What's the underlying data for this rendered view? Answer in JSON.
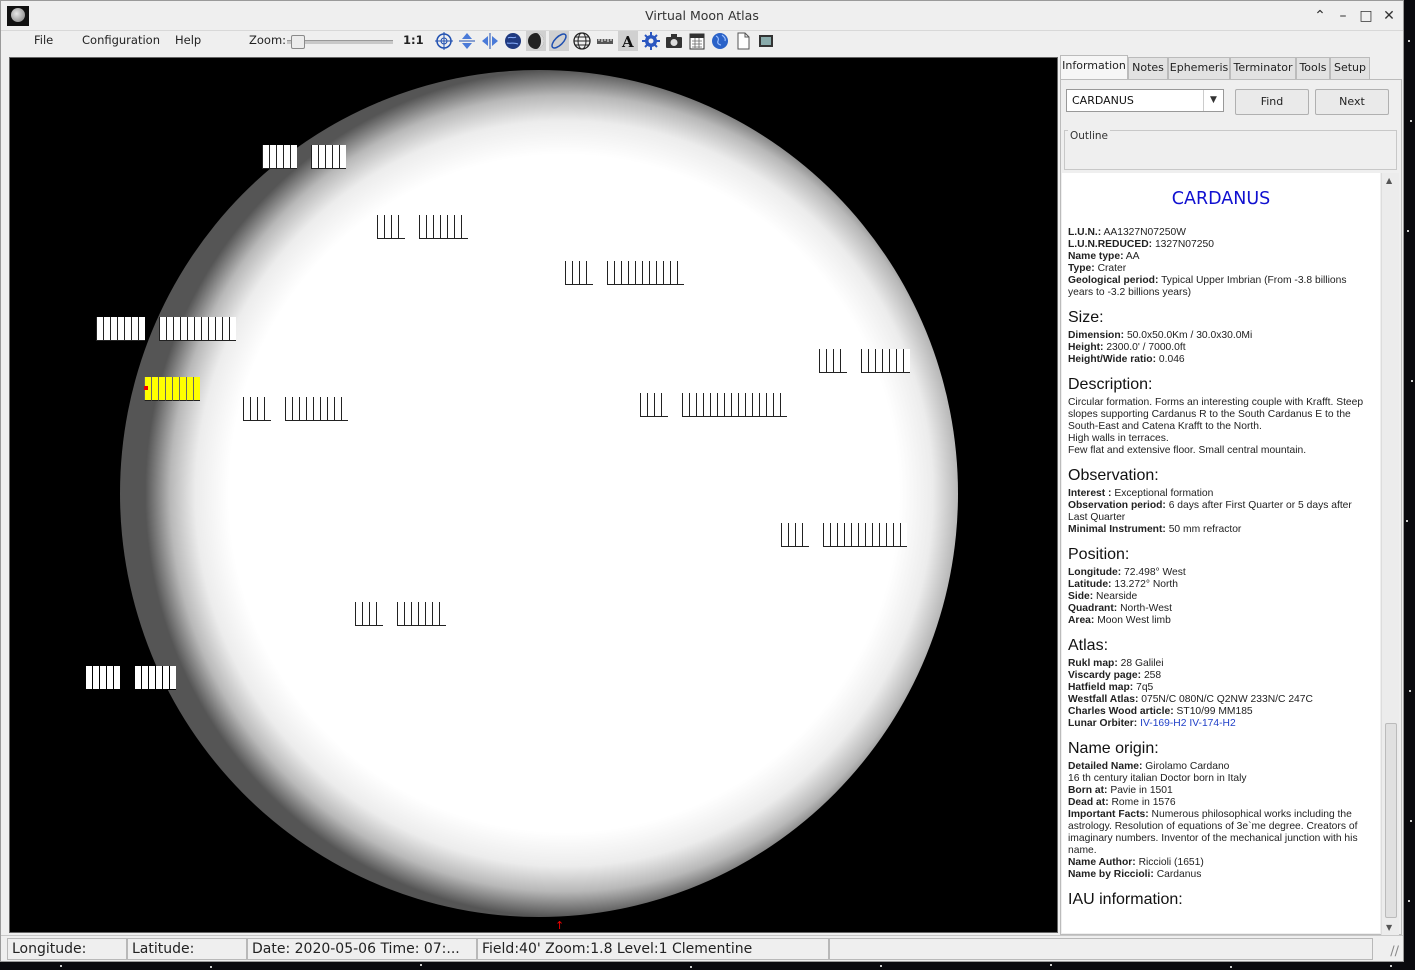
{
  "window": {
    "title": "Virtual Moon Atlas"
  },
  "menu": {
    "file": "File",
    "configuration": "Configuration",
    "help": "Help"
  },
  "toolbar": {
    "zoom_label": "Zoom:",
    "zoom_value": "1:1",
    "zoom_level": 0.02,
    "icons": [
      "target-icon",
      "flip-vertical-icon",
      "flip-horizontal-icon",
      "earth-view-icon",
      "phase-icon",
      "librations-icon",
      "grid-icon",
      "ruler-icon",
      "labels-icon",
      "settings-icon",
      "camera-icon",
      "calendar-icon",
      "globe-icon",
      "document-icon",
      "fullscreen-icon"
    ]
  },
  "tabs": [
    "Information",
    "Notes",
    "Ephemeris",
    "Terminator",
    "Tools",
    "Setup"
  ],
  "search": {
    "value": "CARDANUS",
    "find": "Find",
    "next": "Next",
    "outline": "Outline"
  },
  "info": {
    "title": "CARDANUS",
    "identity": [
      {
        "k": "L.U.N.:",
        "v": " AA1327N07250W"
      },
      {
        "k": "L.U.N.REDUCED:",
        "v": " 1327N07250"
      },
      {
        "k": "Name type:",
        "v": " AA"
      },
      {
        "k": "Type:",
        "v": " Crater"
      },
      {
        "k": "Geological period:",
        "v": " Typical Upper Imbrian (From -3.8 billions years to -3.2 billions years)"
      }
    ],
    "size_title": "Size:",
    "size": [
      {
        "k": "Dimension:",
        "v": " 50.0x50.0Km / 30.0x30.0Mi"
      },
      {
        "k": "Height:",
        "v": " 2300.0' / 7000.0ft"
      },
      {
        "k": "Height/Wide ratio:",
        "v": " 0.046"
      }
    ],
    "description_title": "Description:",
    "description": [
      "Circular formation. Forms an interesting couple with Krafft. Steep slopes supporting Cardanus R to the South Cardanus E to the South-East and Catena Krafft to the North.",
      "High walls in terraces.",
      "Few flat and extensive floor. Small central mountain."
    ],
    "observation_title": "Observation:",
    "observation": [
      {
        "k": "Interest :",
        "v": " Exceptional formation"
      },
      {
        "k": "Observation period:",
        "v": " 6 days after First Quarter or 5 days after Last Quarter"
      },
      {
        "k": "Minimal Instrument:",
        "v": " 50 mm refractor"
      }
    ],
    "position_title": "Position:",
    "position": [
      {
        "k": "Longitude:",
        "v": " 72.498° West"
      },
      {
        "k": "Latitude:",
        "v": " 13.272° North"
      },
      {
        "k": "Side:",
        "v": " Nearside"
      },
      {
        "k": "Quadrant:",
        "v": " North-West"
      },
      {
        "k": "Area:",
        "v": " Moon West limb"
      }
    ],
    "atlas_title": "Atlas:",
    "atlas": [
      {
        "k": "Rukl map:",
        "v": " 28 Galilei"
      },
      {
        "k": "Viscardy page:",
        "v": "  258"
      },
      {
        "k": "Hatfield map:",
        "v": " 7q5"
      },
      {
        "k": "Westfall Atlas:",
        "v": " 075N/C 080N/C Q2NW 233N/C 247C"
      },
      {
        "k": "Charles Wood article:",
        "v": " ST10/99 MM185"
      }
    ],
    "lunar_orbiter_label": "Lunar Orbiter:",
    "lunar_orbiter_links": [
      "IV-169-H2",
      "IV-174-H2"
    ],
    "origin_title": "Name origin:",
    "origin": [
      {
        "k": "Detailed Name:",
        "v": " Girolamo Cardano"
      },
      {
        "k": "",
        "v": "16 th century italian Doctor born in Italy"
      },
      {
        "k": "Born at:",
        "v": " Pavie in 1501"
      },
      {
        "k": "Dead at:",
        "v": " Rome in 1576"
      },
      {
        "k": "Important Facts:",
        "v": " Numerous philosophical works including the astrology. Resolution of equations of 3e`me degree. Creators of imaginary numbers. Inventor of the mechanical junction with his name."
      },
      {
        "k": "Name Author:",
        "v": " Riccioli (1651)"
      },
      {
        "k": "Name by Riccioli:",
        "v": " Cardanus"
      }
    ],
    "iau_title": "IAU information:"
  },
  "status": {
    "longitude": "Longitude:",
    "latitude": "Latitude:",
    "datetime": "Date: 2020-05-06   Time: 07:...",
    "field": "Field:40' Zoom:1.8  Level:1 Clementine"
  },
  "colors": {
    "selected_label": "#ffff00",
    "title_blue": "#1010d0",
    "link": "#2040c8"
  }
}
